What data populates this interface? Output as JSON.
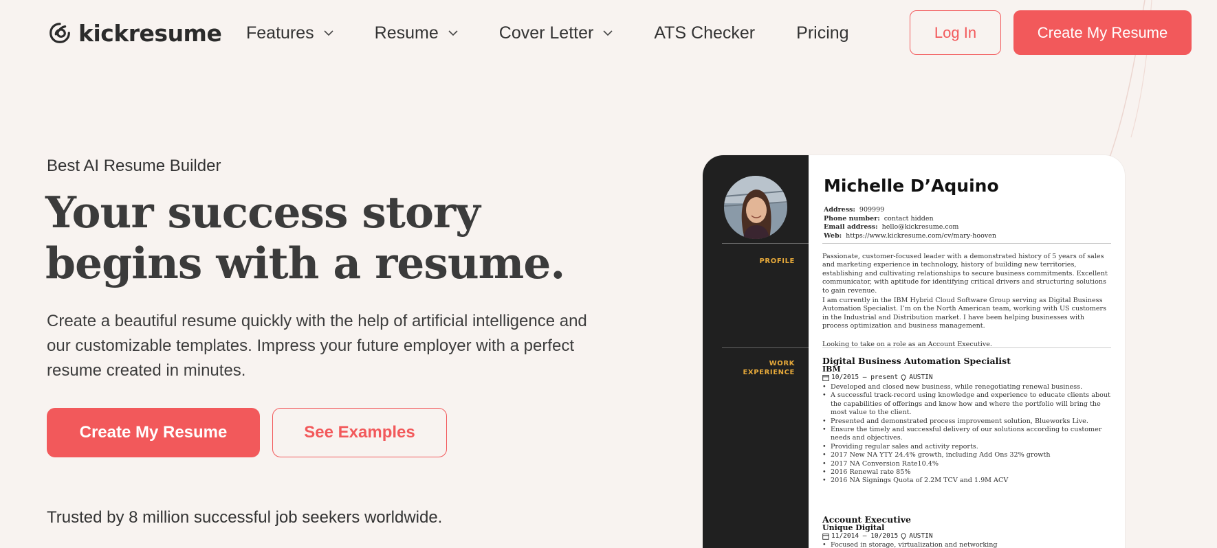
{
  "header": {
    "brand": "kickresume",
    "nav": [
      {
        "label": "Features",
        "dropdown": true
      },
      {
        "label": "Resume",
        "dropdown": true
      },
      {
        "label": "Cover Letter",
        "dropdown": true
      },
      {
        "label": "ATS Checker",
        "dropdown": false
      },
      {
        "label": "Pricing",
        "dropdown": false
      }
    ],
    "login_label": "Log In",
    "cta_label": "Create My Resume"
  },
  "hero": {
    "eyebrow": "Best AI Resume Builder",
    "headline_line1": "Your success story",
    "headline_line2": "begins with a resume.",
    "subtext": "Create a beautiful resume quickly with the help of artificial intelligence and our customizable templates. Impress your future employer with a perfect resume created in minutes.",
    "primary_button": "Create My Resume",
    "secondary_button": "See Examples",
    "trusted": "Trusted by 8 million successful job seekers worldwide."
  },
  "resume": {
    "name": "Michelle D’Aquino",
    "contact": [
      {
        "label": "Address:",
        "value": "909999"
      },
      {
        "label": "Phone number:",
        "value": "contact hidden"
      },
      {
        "label": "Email address:",
        "value": "hello@kickresume.com"
      },
      {
        "label": "Web:",
        "value": "https://www.kickresume.com/cv/mary-hooven"
      }
    ],
    "sections": {
      "profile": "PROFILE",
      "work_line1": "WORK",
      "work_line2": "EXPERIENCE"
    },
    "profile_paragraphs": [
      "Passionate, customer-focused leader with a demonstrated history of 5 years of sales and marketing experience in technology, history of building new territories, establishing and cultivating relationships to secure business commitments. Excellent communicator, with aptitude for identifying critical drivers and structuring solutions to gain revenue.",
      "I am currently in the IBM Hybrid Cloud Software Group serving as Digital Business Automation Specialist. I’m on the North American team, working with US customers in the Industrial and Distribution market. I have been helping businesses with process optimization and business management.",
      "Looking to take on a role as an Account Executive."
    ],
    "jobs": [
      {
        "title": "Digital Business Automation Specialist",
        "company": "IBM",
        "dates": "10/2015 – present",
        "location": "AUSTIN",
        "bullets": [
          "Developed and closed new business, while renegotiating renewal business.",
          "A successful track-record using knowledge and experience  to educate clients about the capabilities of offerings and know how and where the portfolio will bring the most value to the client.",
          "Presented and demonstrated process improvement solution, Blueworks Live.",
          "Ensure the timely and successful delivery of our solutions according to customer needs and objectives.",
          "Providing regular sales and activity reports.",
          "2017 New NA YTY 24.4% growth, including Add Ons 32% growth",
          "2017 NA Conversion Rate10.4%",
          "2016 Renewal rate 85%",
          "2016 NA Signings Quota of 2.2M TCV and 1.9M ACV"
        ]
      },
      {
        "title": "Account Executive",
        "company": "Unique Digital",
        "dates": "11/2014 – 10/2015",
        "location": "AUSTIN",
        "bullets": [
          "Focused in storage, virtualization and networking"
        ]
      }
    ]
  },
  "colors": {
    "accent": "#f2595b",
    "background": "#f8f3f0",
    "resume_sidebar": "#202020",
    "section_label": "#e6a93a"
  },
  "icons": [
    "logo-icon",
    "chevron-down-icon",
    "calendar-icon",
    "location-pin-icon"
  ]
}
